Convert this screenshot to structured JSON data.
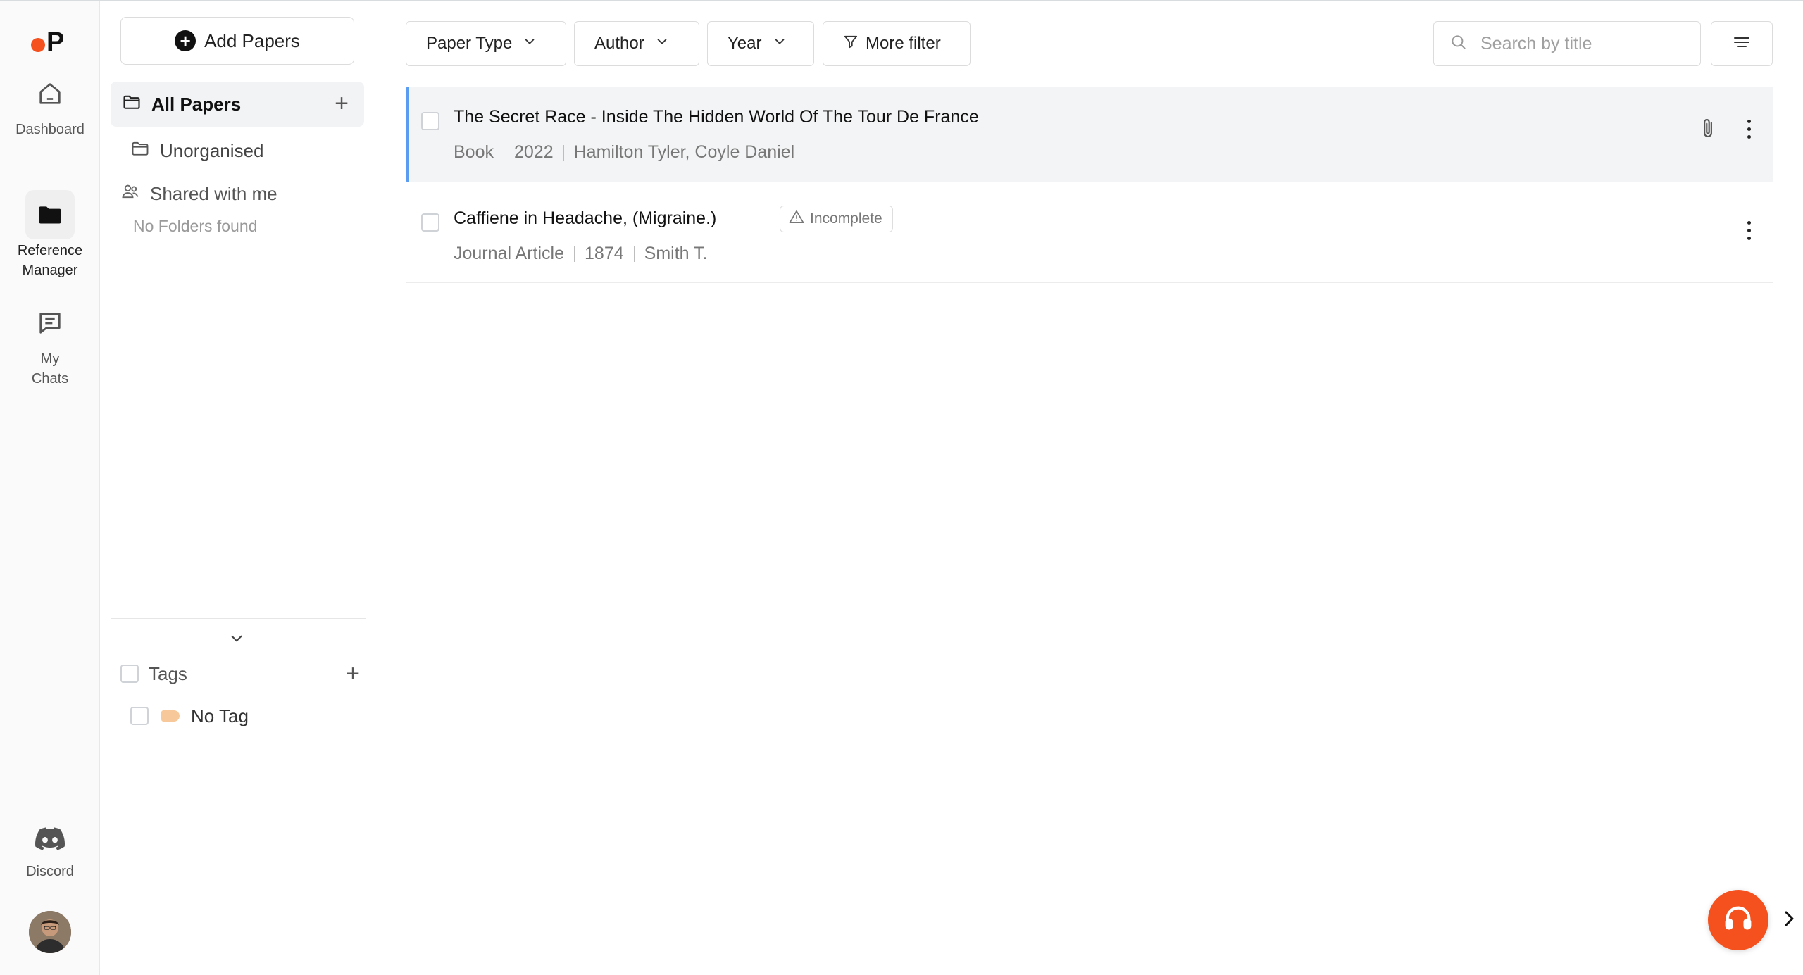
{
  "brand": {
    "letter": "P",
    "accent": "#f4511e"
  },
  "rail": {
    "items": [
      {
        "label": "Dashboard",
        "icon": "home-icon"
      },
      {
        "label": "Reference\nManager",
        "icon": "folder-icon"
      },
      {
        "label": "My\nChats",
        "icon": "chat-icon"
      }
    ],
    "discord_label": "Discord"
  },
  "panel": {
    "add_papers_label": "Add Papers",
    "all_papers_label": "All Papers",
    "unorganised_label": "Unorganised",
    "shared_label": "Shared with me",
    "no_folders_label": "No Folders found",
    "tags_label": "Tags",
    "no_tag_label": "No Tag"
  },
  "filters": {
    "paper_type": "Paper Type",
    "author": "Author",
    "year": "Year",
    "more": "More filter"
  },
  "search": {
    "placeholder": "Search by title",
    "value": ""
  },
  "papers": [
    {
      "title": "The Secret Race - Inside The Hidden World Of The Tour De France",
      "type": "Book",
      "year": "2022",
      "authors": "Hamilton Tyler, Coyle Daniel",
      "has_attachment": true,
      "selected": true
    },
    {
      "title": "Caffiene in Headache, (Migraine.)",
      "type": "Journal Article",
      "year": "1874",
      "authors": "Smith T.",
      "badge": "Incomplete",
      "has_attachment": false,
      "selected": false
    }
  ],
  "colors": {
    "selected_border": "#5b9bf0",
    "help_button": "#f4511e"
  }
}
